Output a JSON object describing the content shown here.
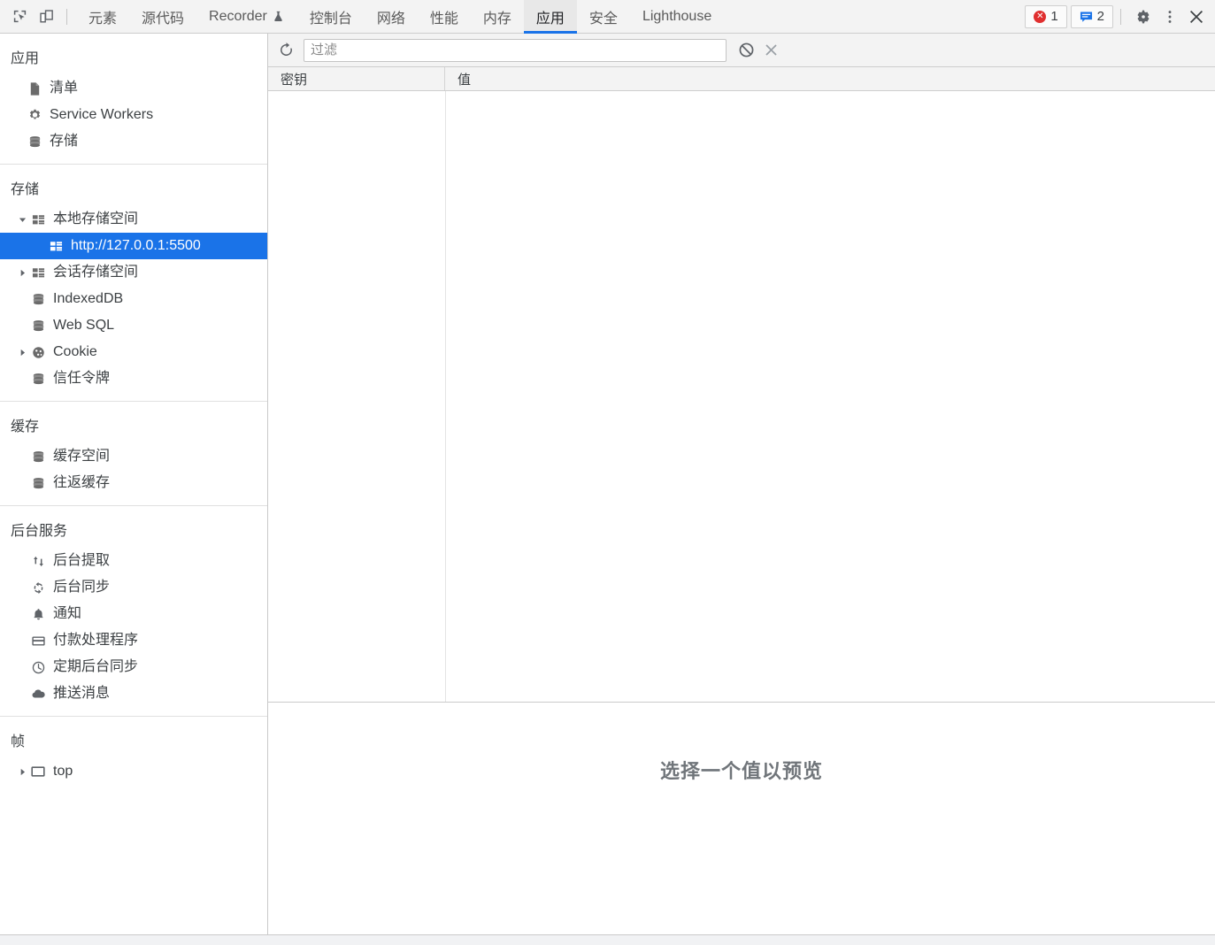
{
  "toolbar": {
    "inspect_icon": "inspect-cursor-icon",
    "device_toggle_icon": "device-toolbar-icon",
    "tabs": [
      {
        "label": "元素",
        "name": "tab-elements",
        "active": false,
        "flask": false
      },
      {
        "label": "源代码",
        "name": "tab-sources",
        "active": false,
        "flask": false
      },
      {
        "label": "Recorder",
        "name": "tab-recorder",
        "active": false,
        "flask": true
      },
      {
        "label": "控制台",
        "name": "tab-console",
        "active": false,
        "flask": false
      },
      {
        "label": "网络",
        "name": "tab-network",
        "active": false,
        "flask": false
      },
      {
        "label": "性能",
        "name": "tab-performance",
        "active": false,
        "flask": false
      },
      {
        "label": "内存",
        "name": "tab-memory",
        "active": false,
        "flask": false
      },
      {
        "label": "应用",
        "name": "tab-application",
        "active": true,
        "flask": false
      },
      {
        "label": "安全",
        "name": "tab-security",
        "active": false,
        "flask": false
      },
      {
        "label": "Lighthouse",
        "name": "tab-lighthouse",
        "active": false,
        "flask": false
      }
    ],
    "error_badge": {
      "count": "1",
      "icon": "error-circle-icon"
    },
    "message_badge": {
      "count": "2",
      "icon": "message-bubble-icon"
    },
    "settings_icon": "gear-icon",
    "more_icon": "kebab-menu-icon",
    "close_icon": "close-icon",
    "accent_color": "#1a73e8",
    "error_color": "#e02f2f",
    "info_color": "#1a73e8"
  },
  "sidebar": {
    "sections": [
      {
        "title": "应用",
        "name": "sidebar-section-application",
        "items": [
          {
            "label": "清单",
            "name": "sidebar-item-manifest",
            "icon": "document-icon",
            "arrow": "none",
            "indent": 1,
            "selected": false
          },
          {
            "label": "Service Workers",
            "name": "sidebar-item-service-workers",
            "icon": "gear-icon",
            "arrow": "none",
            "indent": 1,
            "selected": false
          },
          {
            "label": "存储",
            "name": "sidebar-item-storage-overview",
            "icon": "database-icon",
            "arrow": "none",
            "indent": 1,
            "selected": false
          }
        ]
      },
      {
        "title": "存储",
        "name": "sidebar-section-storage",
        "items": [
          {
            "label": "本地存储空间",
            "name": "sidebar-item-local-storage",
            "icon": "table-grid-icon",
            "arrow": "expanded",
            "indent": 1,
            "selected": false
          },
          {
            "label": "http://127.0.0.1:5500",
            "name": "sidebar-item-local-storage-origin",
            "icon": "table-grid-icon",
            "arrow": "none",
            "indent": 2,
            "selected": true
          },
          {
            "label": "会话存储空间",
            "name": "sidebar-item-session-storage",
            "icon": "table-grid-icon",
            "arrow": "collapsed",
            "indent": 1,
            "selected": false
          },
          {
            "label": "IndexedDB",
            "name": "sidebar-item-indexeddb",
            "icon": "database-icon",
            "arrow": "none",
            "indent": 1,
            "selected": false
          },
          {
            "label": "Web SQL",
            "name": "sidebar-item-websql",
            "icon": "database-icon",
            "arrow": "none",
            "indent": 1,
            "selected": false
          },
          {
            "label": "Cookie",
            "name": "sidebar-item-cookies",
            "icon": "cookie-icon",
            "arrow": "collapsed",
            "indent": 1,
            "selected": false
          },
          {
            "label": "信任令牌",
            "name": "sidebar-item-trust-tokens",
            "icon": "database-icon",
            "arrow": "none",
            "indent": 1,
            "selected": false
          }
        ]
      },
      {
        "title": "缓存",
        "name": "sidebar-section-cache",
        "items": [
          {
            "label": "缓存空间",
            "name": "sidebar-item-cache-storage",
            "icon": "database-icon",
            "arrow": "none",
            "indent": 1,
            "selected": false
          },
          {
            "label": "往返缓存",
            "name": "sidebar-item-back-forward-cache",
            "icon": "database-icon",
            "arrow": "none",
            "indent": 1,
            "selected": false
          }
        ]
      },
      {
        "title": "后台服务",
        "name": "sidebar-section-background-services",
        "items": [
          {
            "label": "后台提取",
            "name": "sidebar-item-background-fetch",
            "icon": "arrows-updown-icon",
            "arrow": "none",
            "indent": 1,
            "selected": false
          },
          {
            "label": "后台同步",
            "name": "sidebar-item-background-sync",
            "icon": "sync-icon",
            "arrow": "none",
            "indent": 1,
            "selected": false
          },
          {
            "label": "通知",
            "name": "sidebar-item-notifications",
            "icon": "bell-icon",
            "arrow": "none",
            "indent": 1,
            "selected": false
          },
          {
            "label": "付款处理程序",
            "name": "sidebar-item-payment-handler",
            "icon": "credit-card-icon",
            "arrow": "none",
            "indent": 1,
            "selected": false
          },
          {
            "label": "定期后台同步",
            "name": "sidebar-item-periodic-background-sync",
            "icon": "clock-icon",
            "arrow": "none",
            "indent": 1,
            "selected": false
          },
          {
            "label": "推送消息",
            "name": "sidebar-item-push-messaging",
            "icon": "cloud-icon",
            "arrow": "none",
            "indent": 1,
            "selected": false
          }
        ]
      },
      {
        "title": "帧",
        "name": "sidebar-section-frames",
        "items": [
          {
            "label": "top",
            "name": "sidebar-item-frame-top",
            "icon": "frame-icon",
            "arrow": "collapsed",
            "indent": 1,
            "selected": false
          }
        ]
      }
    ]
  },
  "main": {
    "toolbar": {
      "refresh_icon": "refresh-icon",
      "filter_placeholder": "过滤",
      "filter_value": "",
      "clear_all_icon": "clear-all-circle-slash-icon",
      "delete_selected_icon": "close-x-icon"
    },
    "table": {
      "columns": [
        {
          "label": "密钥",
          "name": "column-header-key"
        },
        {
          "label": "值",
          "name": "column-header-value"
        }
      ],
      "rows": []
    },
    "preview": {
      "empty_text": "选择一个值以预览"
    }
  }
}
